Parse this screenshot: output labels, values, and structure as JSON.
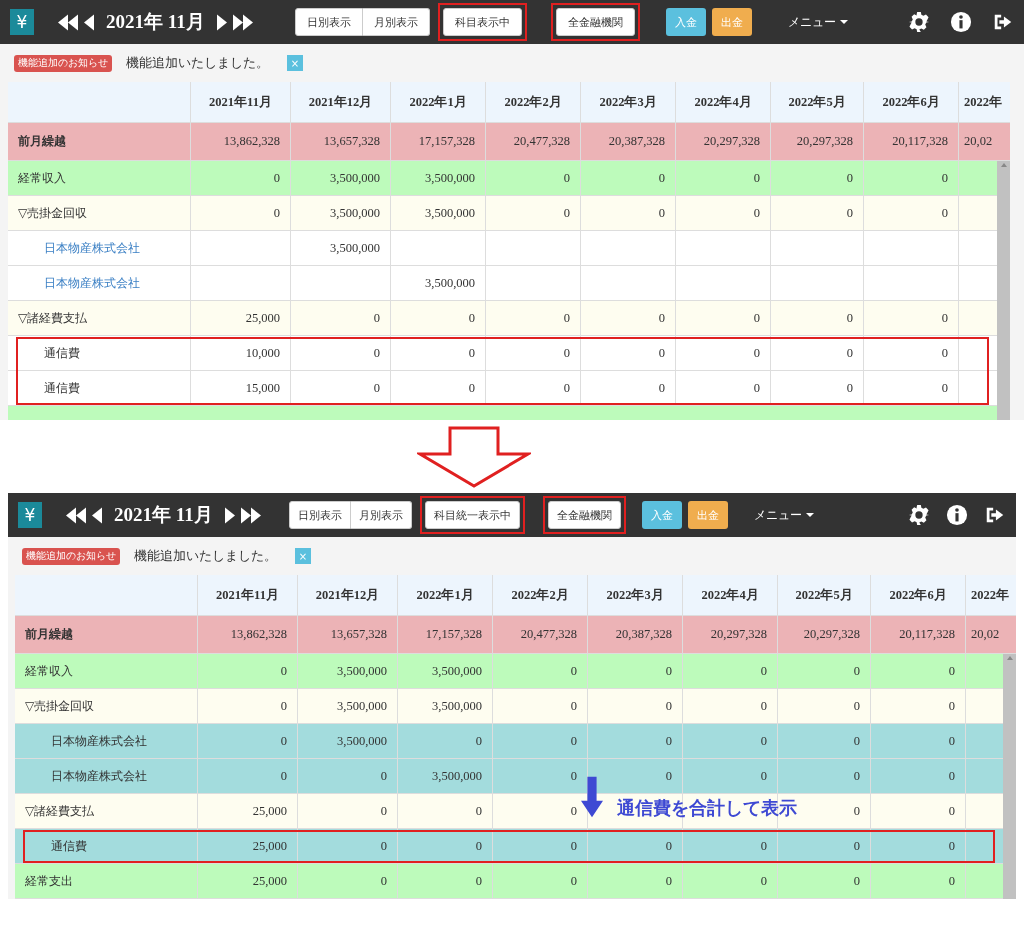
{
  "panels": [
    {
      "toolbar": {
        "logo": "¥",
        "period": "2021年 11月",
        "view_buttons": [
          {
            "label": "日別表示"
          },
          {
            "label": "月別表示"
          }
        ],
        "subject_button": {
          "label": "科目表示中",
          "highlighted": true
        },
        "account_button": {
          "label": "全金融機関",
          "highlighted": true
        },
        "deposit": "入金",
        "withdraw": "出金",
        "menu": "メニュー"
      },
      "notice": {
        "badge": "機能追加のお知らせ",
        "text": "機能追加いたしました。",
        "close": "×"
      },
      "table": {
        "columns": [
          "2021年11月",
          "2021年12月",
          "2022年1月",
          "2022年2月",
          "2022年3月",
          "2022年4月",
          "2022年5月",
          "2022年6月",
          "2022年"
        ],
        "rows": [
          {
            "kind": "carry",
            "label": "前月繰越",
            "cells": [
              {
                "value": "13,862,328"
              },
              {
                "value": "13,657,328"
              },
              {
                "value": "17,157,328"
              },
              {
                "value": "20,477,328"
              },
              {
                "value": "20,387,328"
              },
              {
                "value": "20,297,328"
              },
              {
                "value": "20,297,328"
              },
              {
                "value": "20,117,328"
              },
              {
                "value": "20,02"
              }
            ],
            "highlighted": false
          },
          {
            "kind": "total",
            "label": "経常収入",
            "cells": [
              {
                "value": "0"
              },
              {
                "value": "3,500,000"
              },
              {
                "value": "3,500,000"
              },
              {
                "value": "0"
              },
              {
                "value": "0"
              },
              {
                "value": "0"
              },
              {
                "value": "0"
              },
              {
                "value": "0"
              }
            ],
            "highlighted": false
          },
          {
            "kind": "category",
            "label": "▽売掛金回収",
            "cells": [
              {
                "value": "0"
              },
              {
                "value": "3,500,000"
              },
              {
                "value": "3,500,000"
              },
              {
                "value": "0"
              },
              {
                "value": "0"
              },
              {
                "value": "0"
              },
              {
                "value": "0"
              },
              {
                "value": "0"
              }
            ],
            "highlighted": false
          },
          {
            "kind": "item",
            "label": "日本物産株式会社",
            "cells": [
              {
                "empty": true
              },
              {
                "value": "3,500,000"
              },
              {
                "empty": true
              },
              {
                "empty": true
              },
              {
                "empty": true
              },
              {
                "empty": true
              },
              {
                "empty": true
              },
              {
                "empty": true
              }
            ],
            "highlighted": false
          },
          {
            "kind": "item",
            "label": "日本物産株式会社",
            "cells": [
              {
                "empty": true
              },
              {
                "empty": true
              },
              {
                "value": "3,500,000"
              },
              {
                "empty": true
              },
              {
                "empty": true
              },
              {
                "empty": true
              },
              {
                "empty": true
              },
              {
                "empty": true
              }
            ],
            "highlighted": false
          },
          {
            "kind": "category",
            "label": "▽諸経費支払",
            "cells": [
              {
                "value": "25,000"
              },
              {
                "value": "0"
              },
              {
                "value": "0"
              },
              {
                "value": "0"
              },
              {
                "value": "0"
              },
              {
                "value": "0"
              },
              {
                "value": "0"
              },
              {
                "value": "0"
              }
            ],
            "highlighted": false
          },
          {
            "kind": "item_plain",
            "label": "通信費",
            "cells": [
              {
                "value": "10,000"
              },
              {
                "value": "0"
              },
              {
                "value": "0"
              },
              {
                "value": "0"
              },
              {
                "value": "0"
              },
              {
                "value": "0"
              },
              {
                "value": "0"
              },
              {
                "value": "0"
              }
            ],
            "highlighted": true
          },
          {
            "kind": "item_plain",
            "label": "通信費",
            "cells": [
              {
                "value": "15,000"
              },
              {
                "value": "0"
              },
              {
                "value": "0"
              },
              {
                "value": "0"
              },
              {
                "value": "0"
              },
              {
                "value": "0"
              },
              {
                "value": "0"
              },
              {
                "value": "0"
              }
            ],
            "highlighted": true
          }
        ],
        "cut_off": true
      }
    },
    {
      "toolbar": {
        "logo": "¥",
        "period": "2021年 11月",
        "view_buttons": [
          {
            "label": "日別表示"
          },
          {
            "label": "月別表示"
          }
        ],
        "subject_button": {
          "label": "科目統一表示中",
          "highlighted": true
        },
        "account_button": {
          "label": "全金融機関",
          "highlighted": true
        },
        "deposit": "入金",
        "withdraw": "出金",
        "menu": "メニュー"
      },
      "notice": {
        "badge": "機能追加のお知らせ",
        "text": "機能追加いたしました。",
        "close": "×"
      },
      "table": {
        "columns": [
          "2021年11月",
          "2021年12月",
          "2022年1月",
          "2022年2月",
          "2022年3月",
          "2022年4月",
          "2022年5月",
          "2022年6月",
          "2022年"
        ],
        "rows": [
          {
            "kind": "carry",
            "label": "前月繰越",
            "cells": [
              {
                "value": "13,862,328"
              },
              {
                "value": "13,657,328"
              },
              {
                "value": "17,157,328"
              },
              {
                "value": "20,477,328"
              },
              {
                "value": "20,387,328"
              },
              {
                "value": "20,297,328"
              },
              {
                "value": "20,297,328"
              },
              {
                "value": "20,117,328"
              },
              {
                "value": "20,02"
              }
            ],
            "highlighted": false
          },
          {
            "kind": "total",
            "label": "経常収入",
            "cells": [
              {
                "value": "0"
              },
              {
                "value": "3,500,000"
              },
              {
                "value": "3,500,000"
              },
              {
                "value": "0"
              },
              {
                "value": "0"
              },
              {
                "value": "0"
              },
              {
                "value": "0"
              },
              {
                "value": "0"
              }
            ],
            "highlighted": false
          },
          {
            "kind": "category",
            "label": "▽売掛金回収",
            "cells": [
              {
                "value": "0"
              },
              {
                "value": "3,500,000"
              },
              {
                "value": "3,500,000"
              },
              {
                "value": "0"
              },
              {
                "value": "0"
              },
              {
                "value": "0"
              },
              {
                "value": "0"
              },
              {
                "value": "0"
              }
            ],
            "highlighted": false
          },
          {
            "kind": "merged",
            "label": "日本物産株式会社",
            "cells": [
              {
                "value": "0"
              },
              {
                "value": "3,500,000"
              },
              {
                "value": "0"
              },
              {
                "value": "0"
              },
              {
                "value": "0"
              },
              {
                "value": "0"
              },
              {
                "value": "0"
              },
              {
                "value": "0"
              }
            ],
            "highlighted": false
          },
          {
            "kind": "merged",
            "label": "日本物産株式会社",
            "cells": [
              {
                "value": "0"
              },
              {
                "value": "0"
              },
              {
                "value": "3,500,000"
              },
              {
                "value": "0"
              },
              {
                "value": "0"
              },
              {
                "value": "0"
              },
              {
                "value": "0"
              },
              {
                "value": "0"
              }
            ],
            "highlighted": false
          },
          {
            "kind": "category",
            "label": "▽諸経費支払",
            "cells": [
              {
                "value": "25,000"
              },
              {
                "value": "0"
              },
              {
                "value": "0"
              },
              {
                "value": "0"
              },
              {
                "empty": true
              },
              {
                "empty": true
              },
              {
                "value": "0"
              },
              {
                "value": "0"
              }
            ],
            "highlighted": false
          },
          {
            "kind": "merged",
            "label": "通信費",
            "cells": [
              {
                "value": "25,000"
              },
              {
                "value": "0"
              },
              {
                "value": "0"
              },
              {
                "value": "0"
              },
              {
                "value": "0"
              },
              {
                "value": "0"
              },
              {
                "value": "0"
              },
              {
                "value": "0"
              }
            ],
            "highlighted": true
          },
          {
            "kind": "total",
            "label": "経常支出",
            "cells": [
              {
                "value": "25,000"
              },
              {
                "value": "0"
              },
              {
                "value": "0"
              },
              {
                "value": "0"
              },
              {
                "value": "0"
              },
              {
                "value": "0"
              },
              {
                "value": "0"
              },
              {
                "value": "0"
              }
            ],
            "highlighted": false
          }
        ],
        "cut_off": false
      },
      "annotation": {
        "text": "通信費を合計して表示"
      }
    }
  ]
}
